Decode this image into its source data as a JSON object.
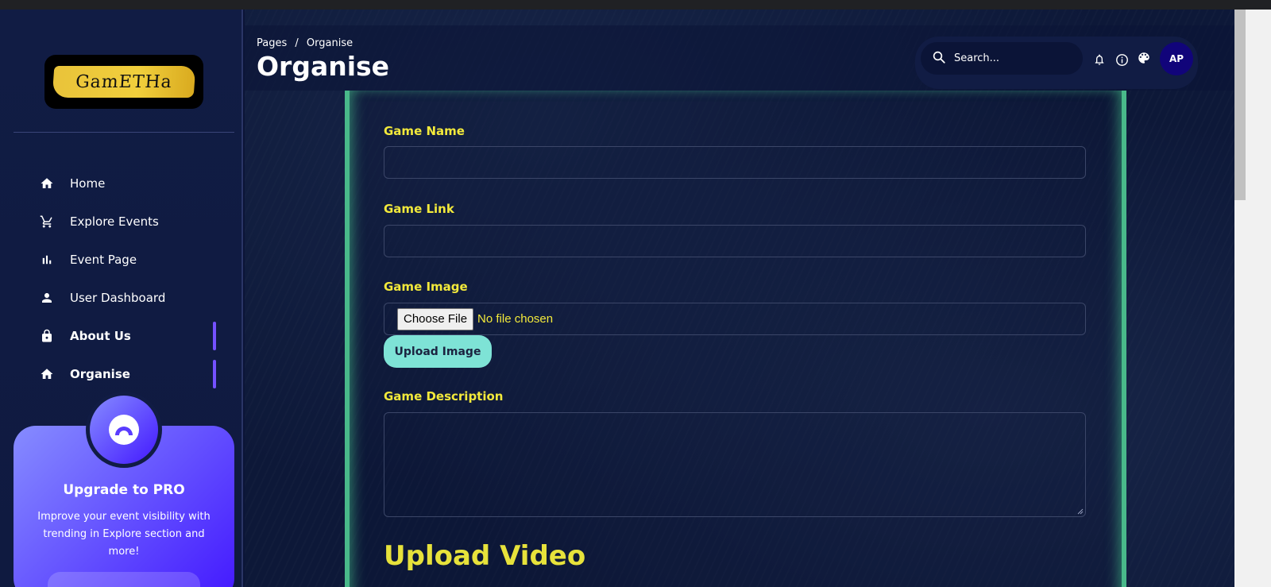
{
  "app": {
    "logo_text": "GamETHa"
  },
  "sidebar": {
    "items": [
      {
        "label": "Home",
        "icon": "home-icon",
        "active": false
      },
      {
        "label": "Explore Events",
        "icon": "cart-icon",
        "active": false
      },
      {
        "label": "Event Page",
        "icon": "bar-chart-icon",
        "active": false
      },
      {
        "label": "User Dashboard",
        "icon": "person-icon",
        "active": false
      },
      {
        "label": "About Us",
        "icon": "lock-icon",
        "active": true
      },
      {
        "label": "Organise",
        "icon": "home-icon",
        "active": true
      }
    ],
    "promo": {
      "title": "Upgrade to PRO",
      "text": "Improve your event visibility with trending in Explore section and more!"
    }
  },
  "header": {
    "breadcrumb_root": "Pages",
    "breadcrumb_sep": "/",
    "breadcrumb_current": "Organise",
    "title": "Organise",
    "search_placeholder": "Search...",
    "avatar_initials": "AP"
  },
  "form": {
    "game_name_label": "Game Name",
    "game_name_value": "",
    "game_link_label": "Game Link",
    "game_link_value": "",
    "game_image_label": "Game Image",
    "choose_file_label": "Choose File",
    "no_file_text": "No file chosen",
    "upload_image_label": "Upload Image",
    "game_description_label": "Game Description",
    "game_description_value": "",
    "upload_video_title": "Upload Video"
  },
  "colors": {
    "accent_purple": "#7551ff",
    "label_yellow": "#f2e93b",
    "upload_button": "#7ee3d6",
    "panel_border_green": "#49b98a"
  }
}
